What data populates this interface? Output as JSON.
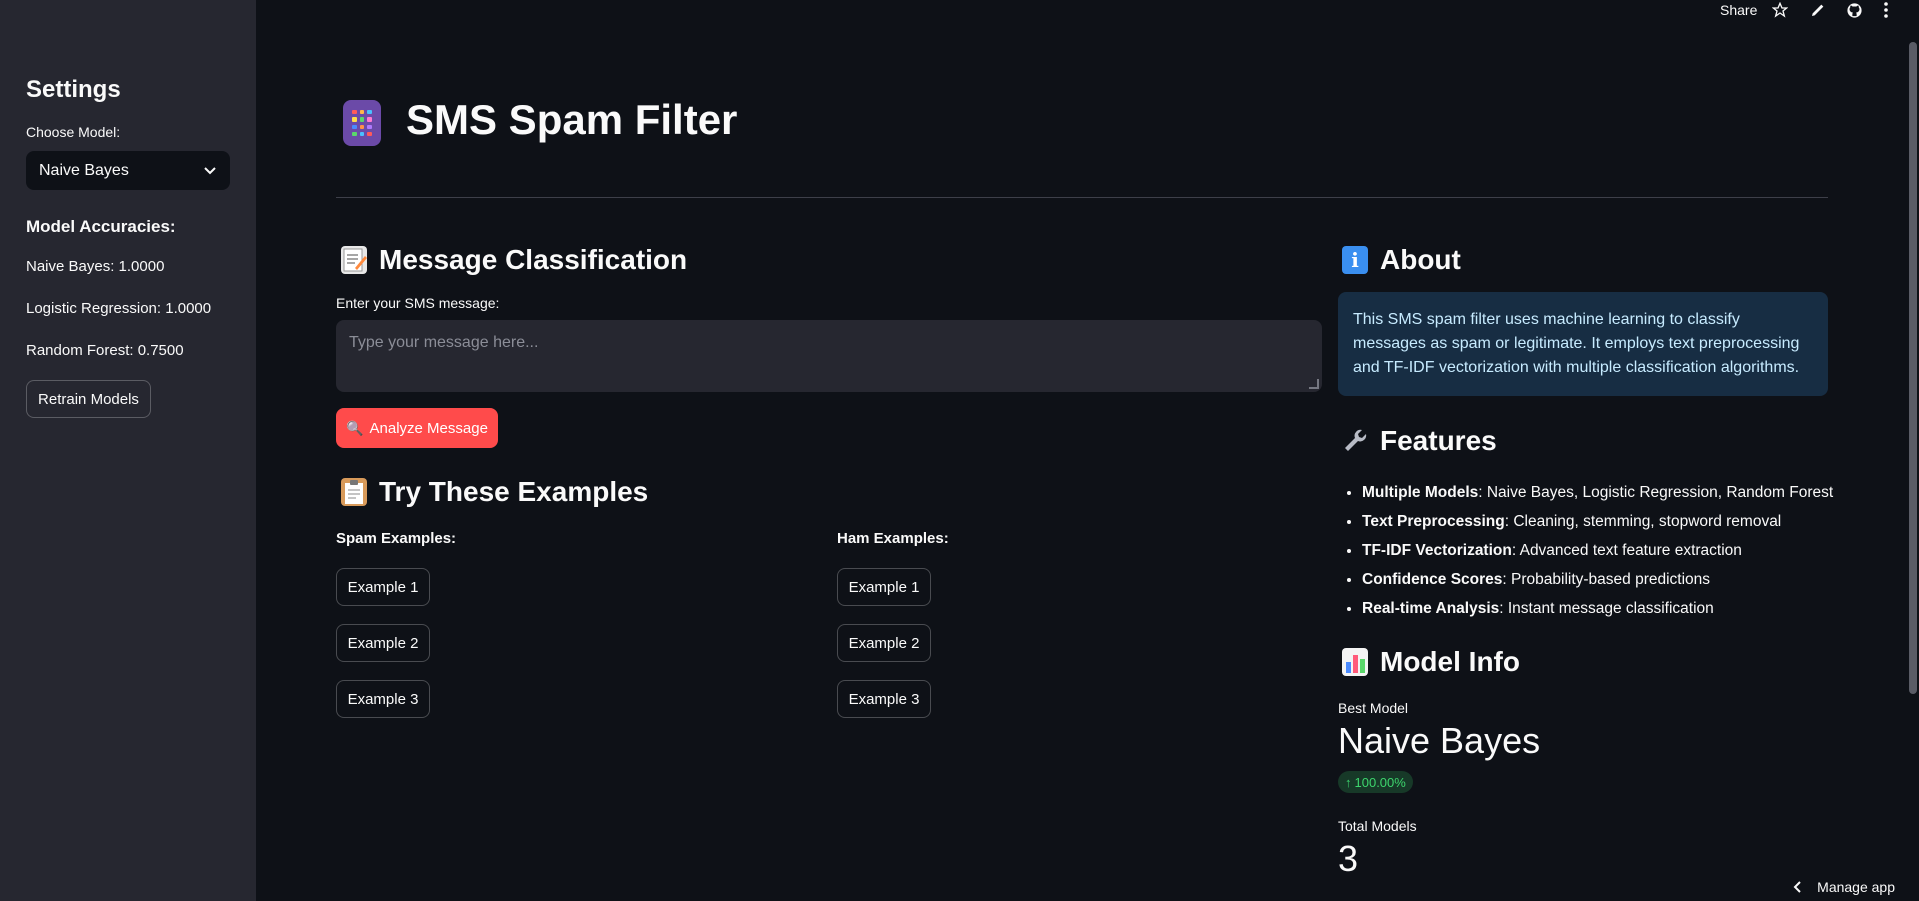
{
  "toolbar": {
    "share_label": "Share",
    "manage_label": "Manage app"
  },
  "sidebar": {
    "title": "Settings",
    "model_label": "Choose Model:",
    "model_selected": "Naive Bayes",
    "accuracies_title": "Model Accuracies:",
    "accuracies": [
      "Naive Bayes: 1.0000",
      "Logistic Regression: 1.0000",
      "Random Forest: 0.7500"
    ],
    "retrain_label": "Retrain Models"
  },
  "header": {
    "title": "SMS Spam Filter",
    "icon": "calculator-icon"
  },
  "classification": {
    "heading": "Message Classification",
    "input_label": "Enter your SMS message:",
    "input_placeholder": "Type your message here...",
    "analyze_label": "Analyze Message",
    "analyze_color": "#ff4b4b"
  },
  "examples": {
    "heading": "Try These Examples",
    "spam_heading": "Spam Examples:",
    "ham_heading": "Ham Examples:",
    "spam": [
      "Example 1",
      "Example 2",
      "Example 3"
    ],
    "ham": [
      "Example 1",
      "Example 2",
      "Example 3"
    ]
  },
  "about": {
    "heading": "About",
    "text": "This SMS spam filter uses machine learning to classify messages as spam or legitimate. It employs text preprocessing and TF-IDF vectorization with multiple classification algorithms."
  },
  "features": {
    "heading": "Features",
    "items": [
      {
        "name": "Multiple Models",
        "desc": ": Naive Bayes, Logistic Regression, Random Forest"
      },
      {
        "name": "Text Preprocessing",
        "desc": ": Cleaning, stemming, stopword removal"
      },
      {
        "name": "TF-IDF Vectorization",
        "desc": ": Advanced text feature extraction"
      },
      {
        "name": "Confidence Scores",
        "desc": ": Probability-based predictions"
      },
      {
        "name": "Real-time Analysis",
        "desc": ": Instant message classification"
      }
    ]
  },
  "model_info": {
    "heading": "Model Info",
    "best_label": "Best Model",
    "best_value": "Naive Bayes",
    "best_delta": "100.00%",
    "total_label": "Total Models",
    "total_value": "3"
  },
  "colors": {
    "background": "#0e1117",
    "sidebar": "#262730",
    "accent": "#ff4b4b",
    "info_bg": "#172d43",
    "delta_green": "#3dd56d"
  }
}
